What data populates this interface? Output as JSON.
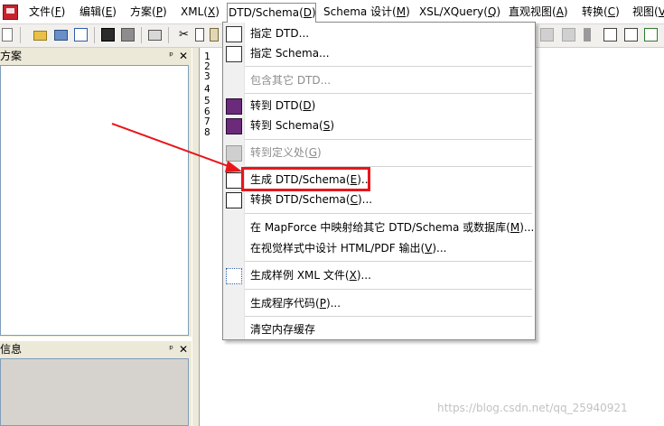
{
  "menubar": {
    "items": [
      {
        "label": "文件(",
        "key": "F",
        "tail": ")"
      },
      {
        "label": "编辑(",
        "key": "E",
        "tail": ")"
      },
      {
        "label": "方案(",
        "key": "P",
        "tail": ")"
      },
      {
        "label": "XML(",
        "key": "X",
        "tail": ")"
      },
      {
        "label": "DTD/Schema(",
        "key": "D",
        "tail": ")"
      },
      {
        "label": "Schema 设计(",
        "key": "M",
        "tail": ")"
      },
      {
        "label": "XSL/XQuery(",
        "key": "Q",
        "tail": ")"
      },
      {
        "label": "直观视图(",
        "key": "A",
        "tail": ")"
      },
      {
        "label": "转换(",
        "key": "C",
        "tail": ")"
      },
      {
        "label": "视图(",
        "key": "V",
        "tail": ")"
      }
    ]
  },
  "panes": {
    "project": {
      "title": "方案",
      "pin": "ᵖ",
      "close": "✕"
    },
    "info": {
      "title": "信息",
      "pin": "ᵖ",
      "close": "✕"
    }
  },
  "editor": {
    "line_numbers": [
      "1",
      "2",
      "3",
      "4",
      "5",
      "6",
      "7",
      "8"
    ]
  },
  "dropdown": {
    "items": [
      {
        "pre": "指定 DTD...",
        "key": "",
        "post": ""
      },
      {
        "pre": "指定 Schema...",
        "key": "",
        "post": ""
      },
      {
        "pre": "包含其它 DTD...",
        "key": "",
        "post": ""
      },
      {
        "pre": "转到 DTD(",
        "key": "D",
        "post": ")"
      },
      {
        "pre": "转到 Schema(",
        "key": "S",
        "post": ")"
      },
      {
        "pre": "转到定义处(",
        "key": "G",
        "post": ")"
      },
      {
        "pre": "生成 DTD/Schema(",
        "key": "E",
        "post": ")..."
      },
      {
        "pre": "转换 DTD/Schema(",
        "key": "C",
        "post": ")..."
      },
      {
        "pre": "在 MapForce 中映射给其它 DTD/Schema 或数据库(",
        "key": "M",
        "post": ")..."
      },
      {
        "pre": "在视觉样式中设计 HTML/PDF 输出(",
        "key": "V",
        "post": ")..."
      },
      {
        "pre": "生成样例 XML 文件(",
        "key": "X",
        "post": ")..."
      },
      {
        "pre": "生成程序代码(",
        "key": "P",
        "post": ")..."
      },
      {
        "pre": "清空内存缓存",
        "key": "",
        "post": ""
      }
    ]
  },
  "annotation": {
    "color": "#e8161b"
  },
  "watermark": "https://blog.csdn.net/qq_25940921"
}
